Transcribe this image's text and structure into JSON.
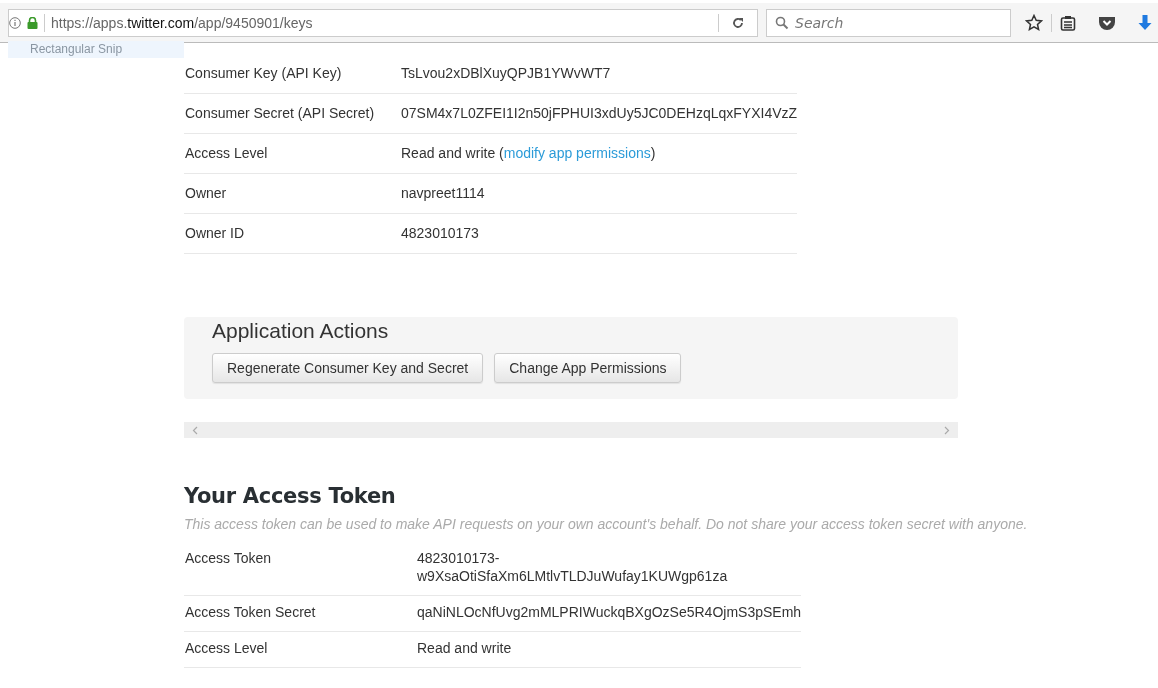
{
  "browser": {
    "url": {
      "prefix": "https://apps.",
      "domain": "twitter.com",
      "path": "/app/9450901/keys"
    },
    "search": {
      "placeholder": "Search"
    },
    "tooltip": "Rectangular Snip"
  },
  "app_keys": [
    {
      "label": "Consumer Key (API Key)",
      "value": "TsLvou2xDBlXuyQPJB1YWvWT7"
    },
    {
      "label": "Consumer Secret (API Secret)",
      "value": "07SM4x7L0ZFEI1I2n50jFPHUI3xdUy5JC0DEHzqLqxFYXI4VzZ"
    },
    {
      "label": "Access Level",
      "value": "Read and write (",
      "link": "modify app permissions",
      "after": ")"
    },
    {
      "label": "Owner",
      "value": "navpreet1114"
    },
    {
      "label": "Owner ID",
      "value": "4823010173"
    }
  ],
  "application_actions": {
    "title": "Application Actions",
    "buttons": [
      "Regenerate Consumer Key and Secret",
      "Change App Permissions"
    ]
  },
  "access_token": {
    "title": "Your Access Token",
    "description": "This access token can be used to make API requests on your own account's behalf. Do not share your access token secret with anyone.",
    "rows": [
      {
        "label": "Access Token",
        "value": "4823010173-w9XsaOtiSfaXm6LMtlvTLDJuWufay1KUWgp61za"
      },
      {
        "label": "Access Token Secret",
        "value": "qaNiNLOcNfUvg2mMLPRIWuckqBXgOzSe5R4OjmS3pSEmh"
      },
      {
        "label": "Access Level",
        "value": "Read and write"
      }
    ]
  }
}
